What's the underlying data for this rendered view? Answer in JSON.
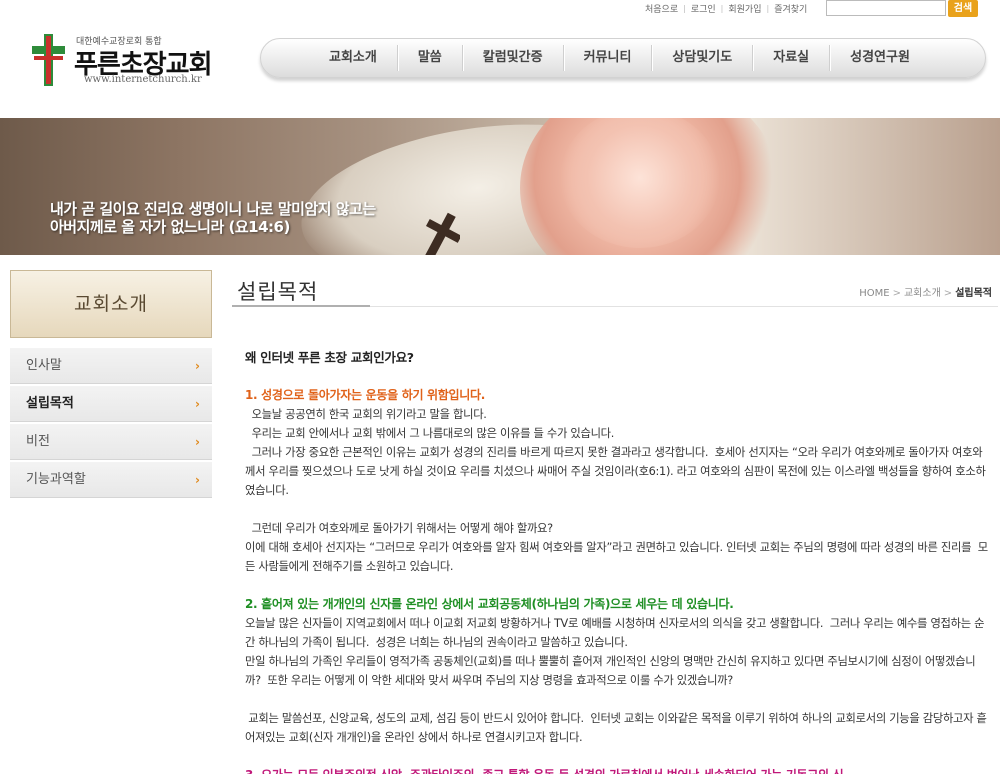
{
  "util": {
    "home": "처음으로",
    "login": "로그인",
    "join": "회원가입",
    "favorites": "즐겨찾기",
    "search_button": "검색"
  },
  "logo": {
    "subtitle": "대한예수교장로회 통합",
    "name": "푸른초장교회",
    "url": "www.internetchurch.kr"
  },
  "nav": [
    "교회소개",
    "말씀",
    "칼럼및간증",
    "커뮤니티",
    "상담및기도",
    "자료실",
    "성경연구원"
  ],
  "banner": {
    "line1": "내가 곧 길이요 진리요 생명이니 나로 말미암지 않고는",
    "line2": "아버지께로 올 자가 없느니라 (요14:6)"
  },
  "sidebar": {
    "title": "교회소개",
    "items": [
      {
        "label": "인사말"
      },
      {
        "label": "설립목적"
      },
      {
        "label": "비전"
      },
      {
        "label": "기능과역할"
      }
    ]
  },
  "page": {
    "title": "설립목적",
    "breadcrumb": [
      "HOME",
      "교회소개",
      "설립목적"
    ]
  },
  "content": {
    "question": "왜 인터넷 푸른 초장 교회인가요?",
    "s1_title": "1. 성경으로 돌아가자는 운동을 하기 위함입니다.",
    "s1_l1": "  오늘날 공공연히 한국 교회의 위기라고 말을 합니다.",
    "s1_l2": "  우리는 교회 안에서나 교회 밖에서 그 나름대로의 많은 이유를 들 수가 있습니다.",
    "s1_l3": "  그러나 가장 중요한 근본적인 이유는 교회가 성경의 진리를 바르게 따르지 못한 결과라고 생각합니다.  호세아 선지자는 “오라 우리가 여호와께로 돌아가자 여호와께서 우리를 찢으셨으나 도로 낫게 하실 것이요 우리를 치셨으나 싸매어 주실 것임이라(호6:1). 라고 여호와의 심판이 목전에 있는 이스라엘 백성들을 향하여 호소하였습니다.",
    "s1_l4": "  그런데 우리가 여호와께로 돌아가기 위해서는 어떻게 해야 할까요?",
    "s1_l5": "이에 대해 호세아 선지자는 “그러므로 우리가 여호와를 알자 힘써 여호와를 알자”라고 권면하고 있습니다. 인터넷 교회는 주님의 명령에 따라 성경의 바른 진리를  모든 사람들에게 전해주기를 소원하고 있습니다.",
    "s2_title": "2. 흩어져 있는 개개인의 신자를 온라인 상에서 교회공동체(하나님의 가족)으로 세우는 데 있습니다.",
    "s2_l1": "오늘날 많은 신자들이 지역교회에서 떠나 이교회 저교회 방황하거나 TV로 예배를 시청하며 신자로서의 의식을 갖고 생활합니다.  그러나 우리는 예수를 영접하는 순간 하나님의 가족이 됩니다.  성경은 너희는 하나님의 권속이라고 말씀하고 있습니다.",
    "s2_l2": "만일 하나님의 가족인 우리들이 영적가족 공동체인(교회)를 떠나 뿔뿔히 흩어져 개인적인 신앙의 명맥만 간신히 유지하고 있다면 주님보시기에 심정이 어떻겠습니까?  또한 우리는 어떻게 이 악한 세대와 맞서 싸우며 주님의 지상 명령을 효과적으로 이룰 수가 있겠습니까?",
    "s2_l3": " 교회는 말씀선포, 신앙교육, 성도의 교제, 섬김 등이 반드시 있어야 합니다.  인터넷 교회는 이와같은 목적을 이루기 위하여 하나의 교회로서의 기능을 감당하고자 흩어져있는 교회(신자 개개인)을 온라인 상에서 하나로 연결시키고자 합니다.",
    "s3_title": "3. 오가는 모든 인본주의적 신앙,  주관타인주의,  종교 통합 운동 등 성경의 가르침에서 벗어난 세속화되어 가는 기독교의 신"
  }
}
